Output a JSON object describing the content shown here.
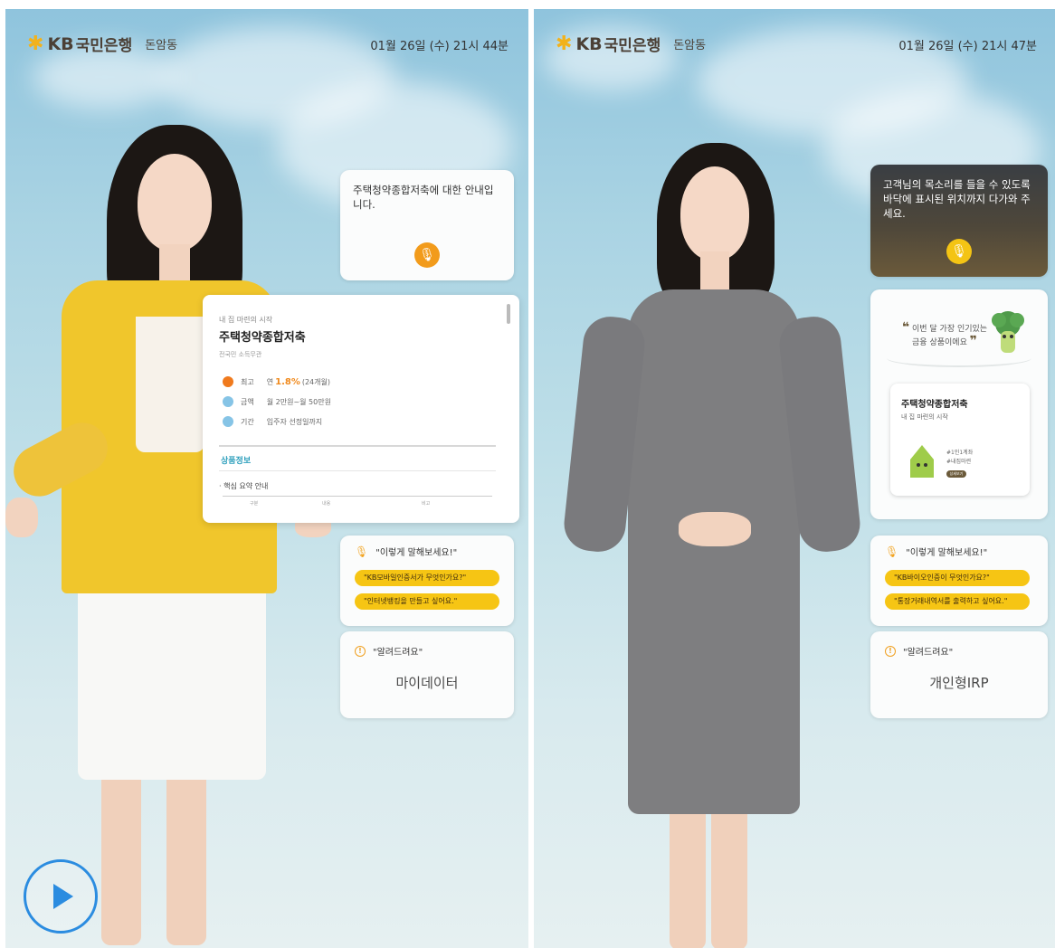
{
  "panels": {
    "left": {
      "brand": {
        "name": "KB국민은행",
        "kb": "KB",
        "korean": "국민은행",
        "branch": "돈암동"
      },
      "datetime": "01월 26일 (수) 21시 44분",
      "bubble": {
        "text": "주택청약종합저축에 대한 안내입니다."
      },
      "product": {
        "subtitle": "내 집 마련의 시작",
        "title": "주택청약종합저축",
        "target": "전국민 소득무관",
        "rows": [
          {
            "icon": "percent-icon",
            "key": "최고",
            "value_prefix": "연",
            "rate": "1.8%",
            "value_suffix": "(24개월)",
            "color": "#f07a1d"
          },
          {
            "icon": "coin-icon",
            "key": "금액",
            "value": "월 2만원~월 50만원",
            "color": "#86c4e6"
          },
          {
            "icon": "calendar-icon",
            "key": "기간",
            "value": "입주자 선정일까지",
            "color": "#86c4e6"
          }
        ],
        "tab": "상품정보",
        "section": "핵심 요약 안내",
        "table_headers": [
          "구분",
          "내용",
          "비고"
        ]
      },
      "say": {
        "header": "\"이렇게 말해보세요!\"",
        "chips": [
          "\"KB모바일인증서가 무엇인가요?\"",
          "\"인터넷뱅킹을 만들고 싶어요.\""
        ]
      },
      "notice": {
        "header": "\"알려드려요\"",
        "main": "마이데이터"
      }
    },
    "right": {
      "brand": {
        "kb": "KB",
        "korean": "국민은행",
        "branch": "돈암동"
      },
      "datetime": "01월 26일 (수) 21시 47분",
      "bubble": {
        "text": "고객님의 목소리를 들을 수 있도록 바닥에 표시된 위치까지 다가와 주세요."
      },
      "recommend": {
        "line1": "이번 달 가장 인기있는",
        "line2": "금융 상품이에요",
        "product_title": "주택청약종합저축",
        "product_sub": "내 집 마련의 시작",
        "tags": [
          "#1인1계좌",
          "#내집마련"
        ],
        "button": "상세보기"
      },
      "say": {
        "header": "\"이렇게 말해보세요!\"",
        "chips": [
          "\"KB바이오인증이 무엇인가요?\"",
          "\"통장거래내역서를 출력하고 싶어요.\""
        ]
      },
      "notice": {
        "header": "\"알려드려요\"",
        "main": "개인형IRP"
      }
    }
  },
  "colors": {
    "brand_yellow": "#f6c514",
    "brand_brown": "#6b5a3a",
    "mic_orange": "#f2a421",
    "play_blue": "#2b8ce0"
  },
  "player": {
    "icon": "play-icon"
  }
}
